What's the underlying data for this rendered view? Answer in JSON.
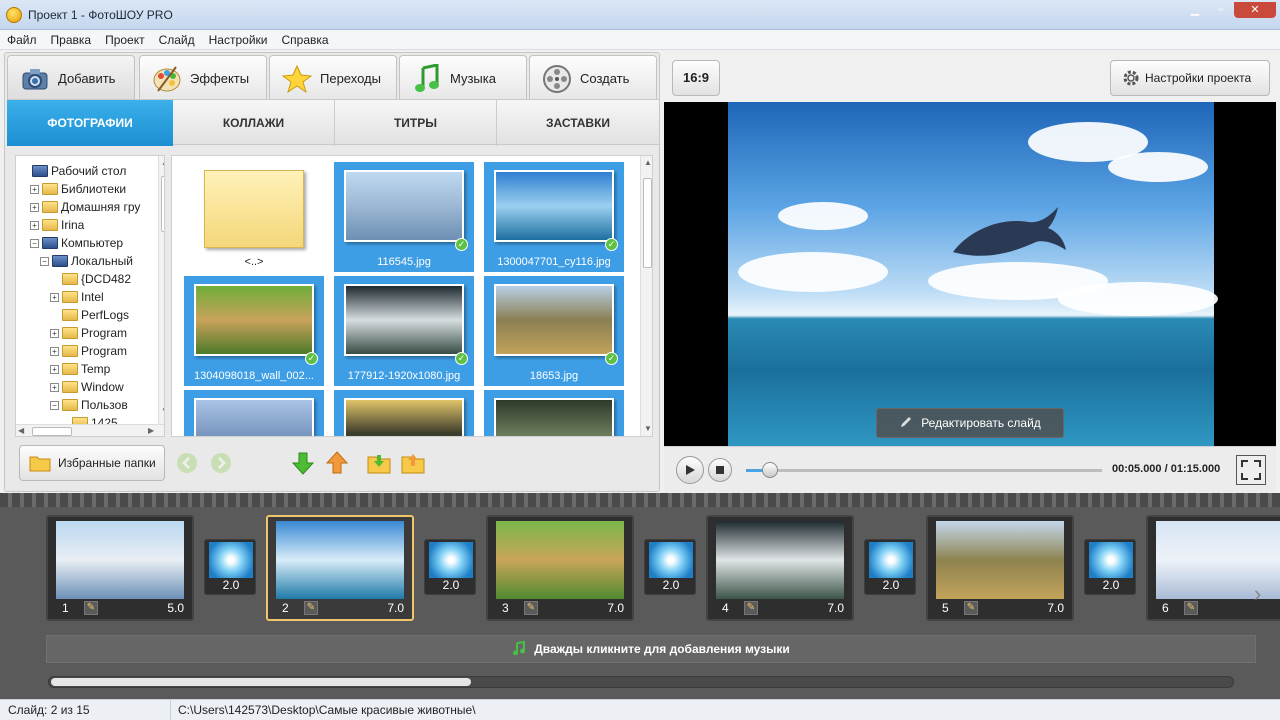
{
  "window": {
    "title": "Проект 1 - ФотоШОУ PRO"
  },
  "menu": [
    "Файл",
    "Правка",
    "Проект",
    "Слайд",
    "Настройки",
    "Справка"
  ],
  "tabs": [
    {
      "label": "Добавить",
      "icon": "camera-icon"
    },
    {
      "label": "Эффекты",
      "icon": "palette-icon"
    },
    {
      "label": "Переходы",
      "icon": "star-icon"
    },
    {
      "label": "Музыка",
      "icon": "music-note-icon"
    },
    {
      "label": "Создать",
      "icon": "film-reel-icon"
    }
  ],
  "subtabs": [
    "ФОТОГРАФИИ",
    "КОЛЛАЖИ",
    "ТИТРЫ",
    "ЗАСТАВКИ"
  ],
  "tree": [
    {
      "label": "Рабочий стол",
      "level": 0,
      "expander": ""
    },
    {
      "label": "Библиотеки",
      "level": 1,
      "expander": "+"
    },
    {
      "label": "Домашняя гру",
      "level": 1,
      "expander": "+"
    },
    {
      "label": "Irina",
      "level": 1,
      "expander": "+"
    },
    {
      "label": "Компьютер",
      "level": 1,
      "expander": "−"
    },
    {
      "label": "Локальный",
      "level": 2,
      "expander": "−"
    },
    {
      "label": "{DCD482",
      "level": 3,
      "expander": ""
    },
    {
      "label": "Intel",
      "level": 3,
      "expander": "+"
    },
    {
      "label": "PerfLogs",
      "level": 3,
      "expander": ""
    },
    {
      "label": "Program",
      "level": 3,
      "expander": "+"
    },
    {
      "label": "Program",
      "level": 3,
      "expander": "+"
    },
    {
      "label": "Temp",
      "level": 3,
      "expander": "+"
    },
    {
      "label": "Window",
      "level": 3,
      "expander": "+"
    },
    {
      "label": "Пользов",
      "level": 3,
      "expander": "−"
    },
    {
      "label": "1425",
      "level": 4,
      "expander": ""
    }
  ],
  "files": [
    {
      "name": "<..>",
      "type": "folder"
    },
    {
      "name": "116545.jpg",
      "type": "image",
      "checked": true,
      "colors": [
        "#bfd9f0",
        "#9bb8d4",
        "#6e8fb3"
      ]
    },
    {
      "name": "1300047701_cy116.jpg",
      "type": "image",
      "checked": true,
      "colors": [
        "#2f7fd1",
        "#9bd0f0",
        "#1d6fa0"
      ]
    },
    {
      "name": "1304098018_wall_002...",
      "type": "image",
      "checked": true,
      "colors": [
        "#6fae3a",
        "#c9a25a",
        "#4d7a2a"
      ]
    },
    {
      "name": "177912-1920x1080.jpg",
      "type": "image",
      "checked": true,
      "colors": [
        "#1d2a2f",
        "#d6dde0",
        "#384d45"
      ]
    },
    {
      "name": "18653.jpg",
      "type": "image",
      "checked": true,
      "colors": [
        "#b8cfe6",
        "#8a7f52",
        "#c2a25a"
      ]
    },
    {
      "name": "",
      "type": "image",
      "checked": false,
      "colors": [
        "#a9c4e6",
        "#7a97c0",
        "#5d7ba6"
      ]
    },
    {
      "name": "",
      "type": "image",
      "checked": false,
      "colors": [
        "#e0c46a",
        "#3a3a2a",
        "#8aa04a"
      ]
    },
    {
      "name": "",
      "type": "image",
      "checked": false,
      "colors": [
        "#2d3a2a",
        "#6a7a5a",
        "#9aa88a"
      ]
    }
  ],
  "favorites_button": "Избранные папки",
  "ratio_button": "16:9",
  "settings_button": "Настройки проекта",
  "edit_slide_button": "Редактировать слайд",
  "player": {
    "time": "00:05.000 / 01:15.000",
    "position_fraction": 0.067
  },
  "slides": [
    {
      "num": "1",
      "duration": "5.0",
      "active": false,
      "colors": [
        "#bcd8f2",
        "#e8eef3",
        "#6d90b8"
      ]
    },
    {
      "num": "2",
      "duration": "7.0",
      "active": true,
      "colors": [
        "#3a89d4",
        "#d8ecf8",
        "#1f7aa8"
      ]
    },
    {
      "num": "3",
      "duration": "7.0",
      "active": false,
      "colors": [
        "#7ab74a",
        "#caa55a",
        "#4f8a2f"
      ]
    },
    {
      "num": "4",
      "duration": "7.0",
      "active": false,
      "colors": [
        "#1e2a2e",
        "#dfe4e6",
        "#3d5548"
      ]
    },
    {
      "num": "5",
      "duration": "7.0",
      "active": false,
      "colors": [
        "#c4d8ec",
        "#8d8350",
        "#c3a35b"
      ]
    },
    {
      "num": "6",
      "duration": "",
      "active": false,
      "colors": [
        "#d6e4f4",
        "#eef2f8",
        "#a9bbd6"
      ]
    }
  ],
  "transitions": [
    "2.0",
    "2.0",
    "2.0",
    "2.0",
    "2.0"
  ],
  "music_hint": "Дважды кликните для добавления музыки",
  "status": {
    "slide": "Слайд: 2 из 15",
    "path": "C:\\Users\\142573\\Desktop\\Самые красивые животные\\"
  }
}
